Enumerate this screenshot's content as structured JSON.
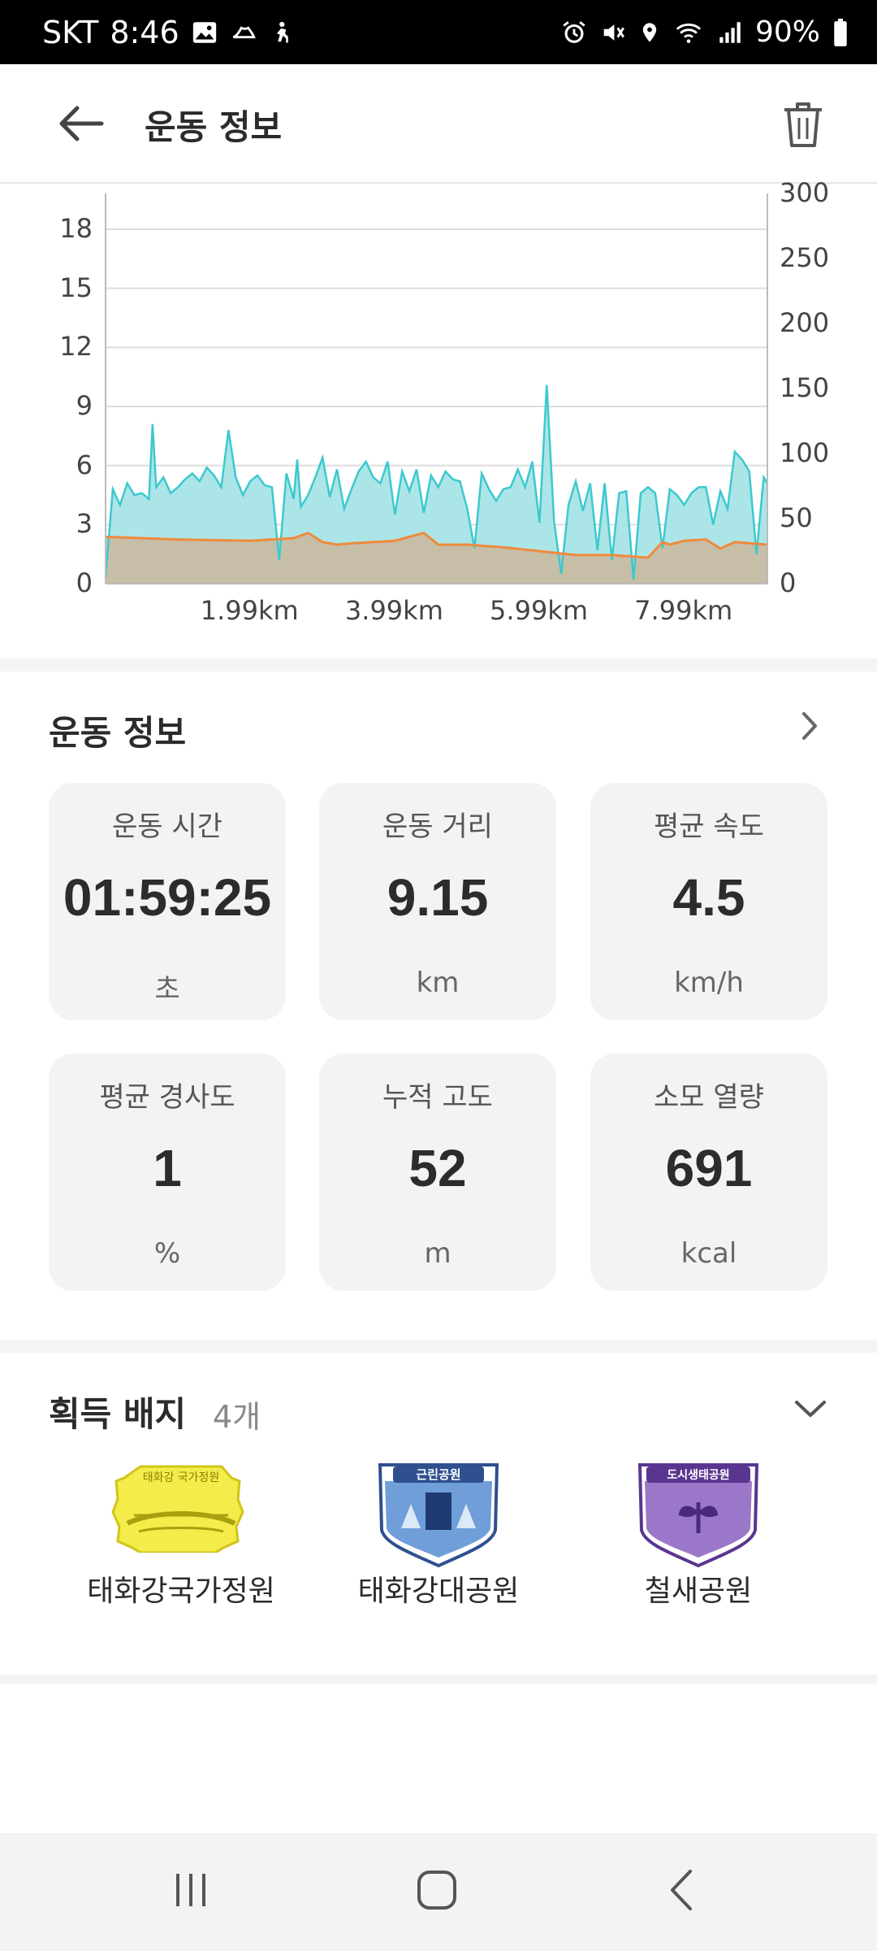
{
  "status_bar": {
    "carrier": "SKT",
    "time": "8:46",
    "battery": "90%"
  },
  "app_bar": {
    "title": "운동 정보"
  },
  "chart_data": {
    "type": "area",
    "x_tick_labels": [
      "1.99km",
      "3.99km",
      "5.99km",
      "7.99km"
    ],
    "y_left_ticks": [
      "0",
      "3",
      "6",
      "9",
      "12",
      "15",
      "18"
    ],
    "y_right_ticks": [
      "0",
      "50",
      "100",
      "150",
      "200",
      "250",
      "300"
    ],
    "ylim_left": [
      0,
      20
    ],
    "ylim_right": [
      0,
      300
    ],
    "xlim_km": [
      0,
      9.15
    ],
    "grid": true,
    "series": [
      {
        "axis": "left",
        "color": "#3cc9cf",
        "fill": "#a8e4e6",
        "x": [
          0.0,
          0.1,
          0.2,
          0.3,
          0.4,
          0.5,
          0.6,
          0.65,
          0.7,
          0.8,
          0.9,
          1.0,
          1.1,
          1.2,
          1.3,
          1.4,
          1.5,
          1.6,
          1.7,
          1.8,
          1.9,
          2.0,
          2.1,
          2.2,
          2.3,
          2.4,
          2.5,
          2.6,
          2.65,
          2.7,
          2.8,
          2.9,
          3.0,
          3.1,
          3.2,
          3.3,
          3.4,
          3.5,
          3.6,
          3.7,
          3.8,
          3.9,
          4.0,
          4.1,
          4.2,
          4.3,
          4.4,
          4.5,
          4.6,
          4.7,
          4.8,
          4.9,
          5.0,
          5.1,
          5.2,
          5.3,
          5.4,
          5.5,
          5.6,
          5.7,
          5.8,
          5.9,
          6.0,
          6.1,
          6.2,
          6.3,
          6.4,
          6.5,
          6.6,
          6.7,
          6.8,
          6.9,
          7.0,
          7.1,
          7.2,
          7.3,
          7.4,
          7.5,
          7.6,
          7.7,
          7.8,
          7.9,
          8.0,
          8.1,
          8.2,
          8.3,
          8.4,
          8.5,
          8.6,
          8.7,
          8.8,
          8.9,
          9.0,
          9.1,
          9.15
        ],
        "y": [
          0.3,
          4.8,
          4.0,
          5.1,
          4.5,
          4.6,
          4.3,
          8.1,
          4.9,
          5.4,
          4.6,
          4.9,
          5.3,
          5.6,
          5.2,
          5.9,
          5.5,
          4.9,
          7.8,
          5.4,
          4.5,
          5.2,
          5.5,
          5.0,
          4.9,
          1.2,
          5.6,
          4.3,
          6.3,
          3.9,
          4.5,
          5.4,
          6.4,
          4.4,
          5.8,
          3.8,
          4.8,
          5.7,
          6.2,
          5.4,
          5.1,
          6.2,
          3.5,
          5.7,
          4.7,
          5.8,
          3.6,
          5.5,
          4.9,
          5.7,
          5.3,
          5.2,
          3.8,
          1.8,
          5.6,
          4.8,
          4.2,
          4.8,
          4.9,
          5.8,
          4.9,
          6.2,
          3.1,
          10.1,
          3.2,
          0.5,
          4.0,
          5.2,
          3.7,
          5.1,
          1.7,
          5.1,
          1.2,
          4.6,
          4.7,
          0.2,
          4.6,
          4.9,
          4.6,
          1.8,
          4.8,
          4.5,
          4.0,
          4.6,
          4.9,
          4.9,
          3.0,
          4.7,
          3.8,
          6.7,
          6.3,
          5.7,
          1.5,
          5.4,
          5.1
        ]
      },
      {
        "axis": "right",
        "color": "#f08a3c",
        "fill": "#c9b9a0",
        "x": [
          0.0,
          1.0,
          2.0,
          2.6,
          2.8,
          3.0,
          3.2,
          3.4,
          4.0,
          4.4,
          4.6,
          5.0,
          5.5,
          6.0,
          6.5,
          7.0,
          7.5,
          7.7,
          7.8,
          8.0,
          8.3,
          8.5,
          8.7,
          9.15
        ],
        "y": [
          36,
          34,
          33,
          35,
          39,
          32,
          30,
          31,
          33,
          39,
          30,
          30,
          28,
          25,
          22,
          22,
          20,
          32,
          30,
          33,
          34,
          27,
          32,
          30
        ]
      }
    ]
  },
  "workout": {
    "section_title": "운동 정보",
    "stats": [
      {
        "label": "운동 시간",
        "value": "01:59:25",
        "unit": "초"
      },
      {
        "label": "운동 거리",
        "value": "9.15",
        "unit": "km"
      },
      {
        "label": "평균 속도",
        "value": "4.5",
        "unit": "km/h"
      },
      {
        "label": "평균 경사도",
        "value": "1",
        "unit": "%"
      },
      {
        "label": "누적 고도",
        "value": "52",
        "unit": "m"
      },
      {
        "label": "소모 열량",
        "value": "691",
        "unit": "kcal"
      }
    ]
  },
  "badges": {
    "title": "획득 배지",
    "count": "4개",
    "items": [
      {
        "name": "태화강국가정원",
        "badge_text": "태화강 국가정원",
        "color": "#e3d61c"
      },
      {
        "name": "태화강대공원",
        "badge_text": "근린공원",
        "color": "#3d6fb8"
      },
      {
        "name": "철새공원",
        "badge_text": "도시생태공원",
        "color": "#8257b8"
      }
    ]
  },
  "icons": {
    "back": "arrow-left-icon",
    "delete": "trash-icon",
    "more": "chevron-right-icon",
    "expand": "chevron-down-icon"
  }
}
